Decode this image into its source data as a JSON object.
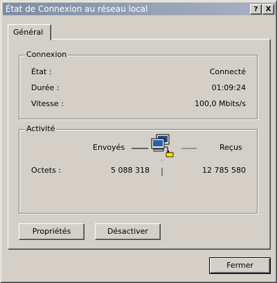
{
  "window": {
    "title": "État de Connexion au réseau local",
    "help_btn": "?",
    "close_btn": "X"
  },
  "tabs": [
    {
      "label": "Général"
    }
  ],
  "connexion": {
    "title": "Connexion",
    "rows": [
      {
        "label": "État :",
        "value": "Connecté"
      },
      {
        "label": "Durée :",
        "value": "01:09:24"
      },
      {
        "label": "Vitesse :",
        "value": "100,0 Mbits/s"
      }
    ]
  },
  "activite": {
    "title": "Activité",
    "sent_label": "Envoyés",
    "received_label": "Reçus",
    "bytes_label": "Octets :",
    "bytes_sent": "5 088 318",
    "bytes_received": "12 785 580",
    "icon": "network-activity-icon"
  },
  "buttons": {
    "properties": "Propriétés",
    "disable": "Désactiver",
    "close": "Fermer"
  }
}
